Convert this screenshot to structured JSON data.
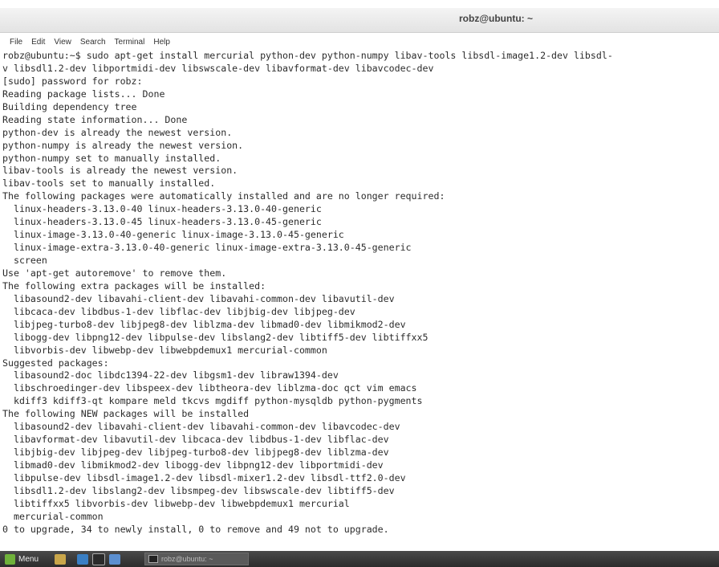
{
  "window": {
    "title": "robz@ubuntu: ~"
  },
  "menubar": {
    "items": [
      "File",
      "Edit",
      "View",
      "Search",
      "Terminal",
      "Help"
    ]
  },
  "terminal": {
    "lines": [
      "robz@ubuntu:~$ sudo apt-get install mercurial python-dev python-numpy libav-tools libsdl-image1.2-dev libsdl-",
      "v libsdl1.2-dev libportmidi-dev libswscale-dev libavformat-dev libavcodec-dev",
      "[sudo] password for robz:",
      "Reading package lists... Done",
      "Building dependency tree",
      "Reading state information... Done",
      "python-dev is already the newest version.",
      "python-numpy is already the newest version.",
      "python-numpy set to manually installed.",
      "libav-tools is already the newest version.",
      "libav-tools set to manually installed.",
      "The following packages were automatically installed and are no longer required:",
      "  linux-headers-3.13.0-40 linux-headers-3.13.0-40-generic",
      "  linux-headers-3.13.0-45 linux-headers-3.13.0-45-generic",
      "  linux-image-3.13.0-40-generic linux-image-3.13.0-45-generic",
      "  linux-image-extra-3.13.0-40-generic linux-image-extra-3.13.0-45-generic",
      "  screen",
      "Use 'apt-get autoremove' to remove them.",
      "The following extra packages will be installed:",
      "  libasound2-dev libavahi-client-dev libavahi-common-dev libavutil-dev",
      "  libcaca-dev libdbus-1-dev libflac-dev libjbig-dev libjpeg-dev",
      "  libjpeg-turbo8-dev libjpeg8-dev liblzma-dev libmad0-dev libmikmod2-dev",
      "  libogg-dev libpng12-dev libpulse-dev libslang2-dev libtiff5-dev libtiffxx5",
      "  libvorbis-dev libwebp-dev libwebpdemux1 mercurial-common",
      "Suggested packages:",
      "  libasound2-doc libdc1394-22-dev libgsm1-dev libraw1394-dev",
      "  libschroedinger-dev libspeex-dev libtheora-dev liblzma-doc qct vim emacs",
      "  kdiff3 kdiff3-qt kompare meld tkcvs mgdiff python-mysqldb python-pygments",
      "The following NEW packages will be installed",
      "  libasound2-dev libavahi-client-dev libavahi-common-dev libavcodec-dev",
      "  libavformat-dev libavutil-dev libcaca-dev libdbus-1-dev libflac-dev",
      "  libjbig-dev libjpeg-dev libjpeg-turbo8-dev libjpeg8-dev liblzma-dev",
      "  libmad0-dev libmikmod2-dev libogg-dev libpng12-dev libportmidi-dev",
      "  libpulse-dev libsdl-image1.2-dev libsdl-mixer1.2-dev libsdl-ttf2.0-dev",
      "  libsdl1.2-dev libslang2-dev libsmpeg-dev libswscale-dev libtiff5-dev",
      "  libtiffxx5 libvorbis-dev libwebp-dev libwebpdemux1 mercurial",
      "  mercurial-common",
      "0 to upgrade, 34 to newly install, 0 to remove and 49 not to upgrade."
    ]
  },
  "taskbar": {
    "menu_label": "Menu",
    "task_label": "robz@ubuntu: ~",
    "colors": {
      "mint": "#6fb13a",
      "folder": "#c9a64a",
      "browser": "#3a7fc4",
      "terminal": "#2a2a2a",
      "files": "#5b8fd0"
    }
  }
}
